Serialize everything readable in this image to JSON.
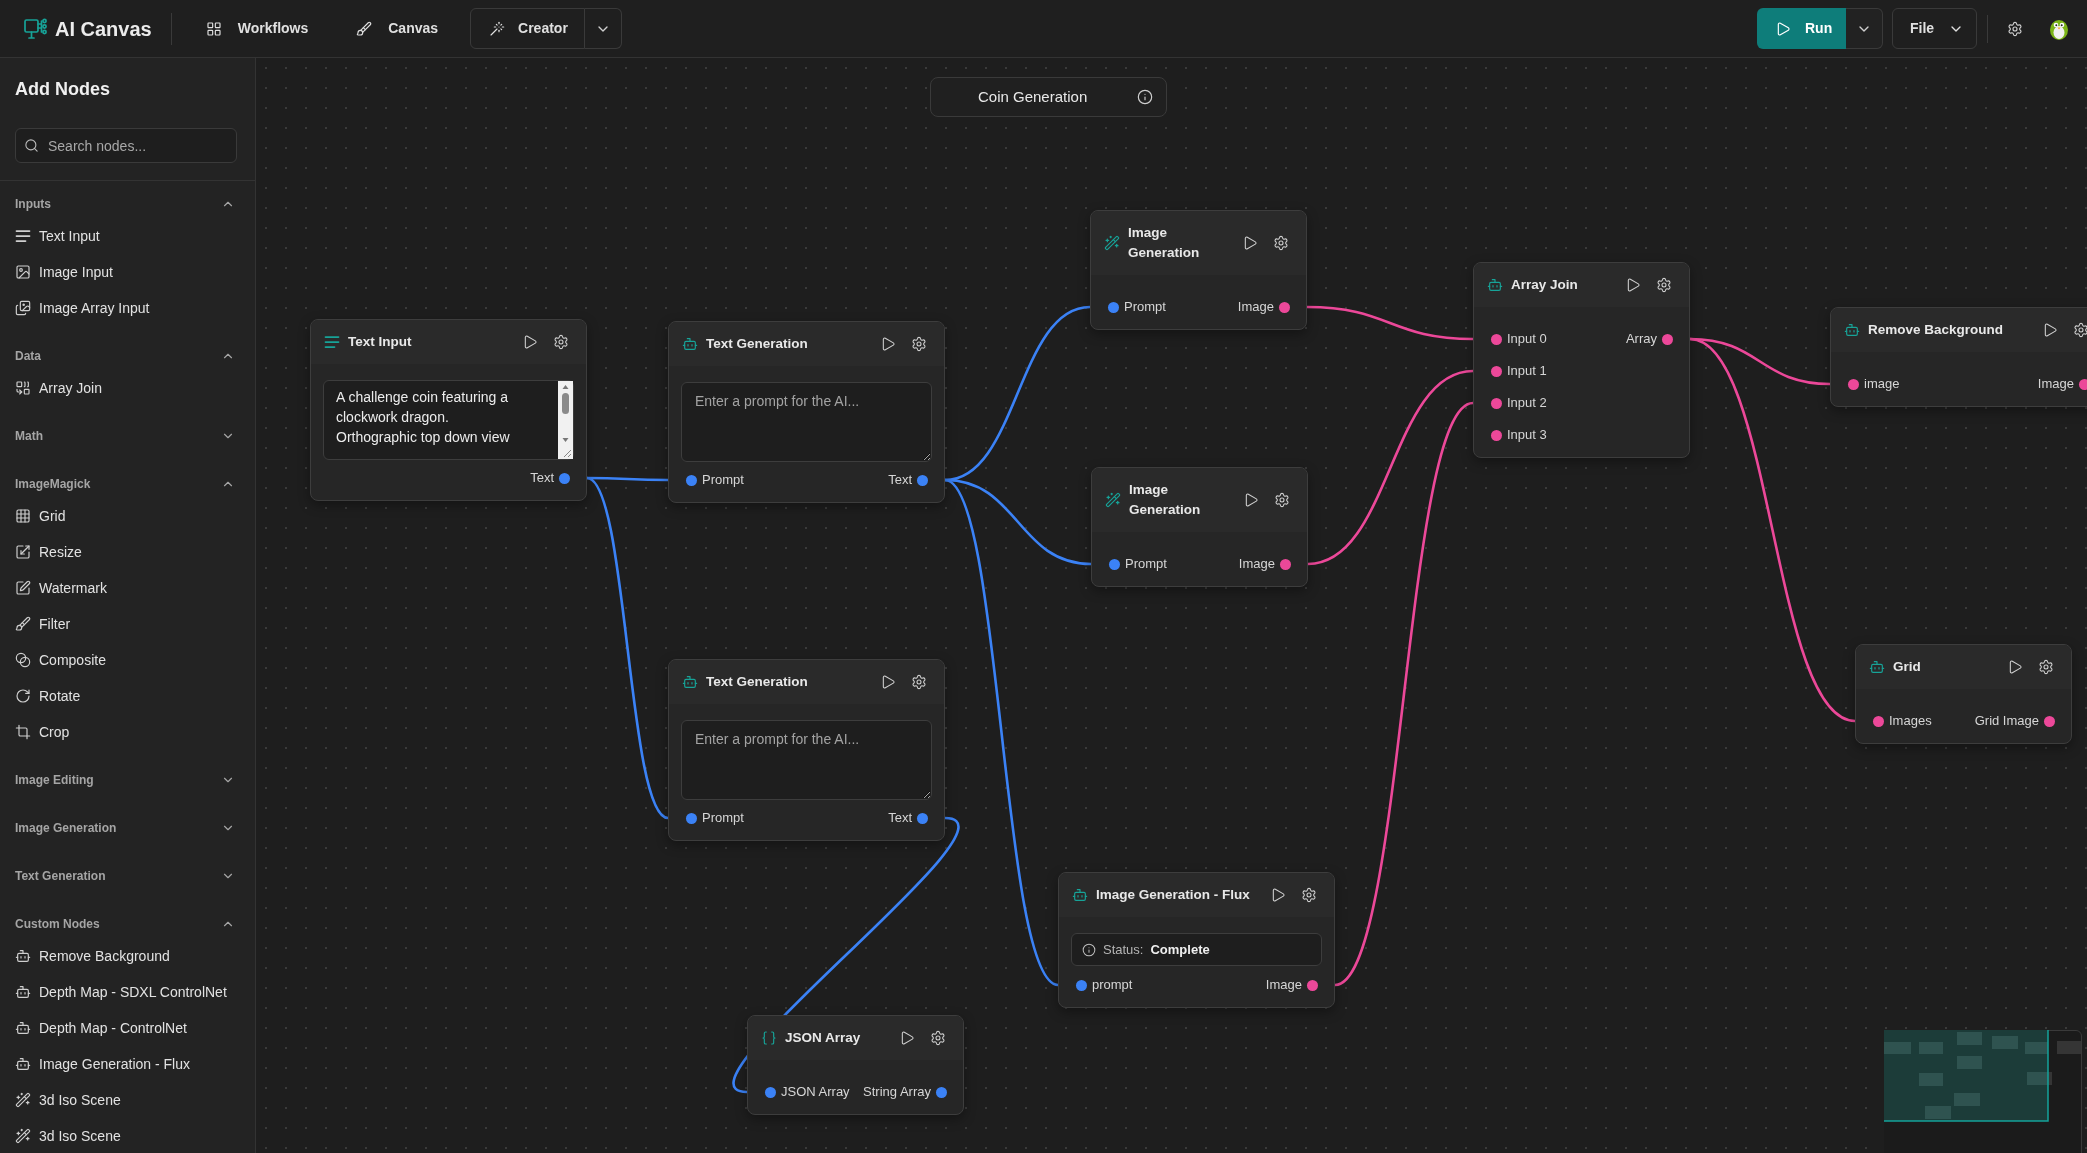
{
  "header": {
    "app_name": "AI Canvas",
    "nav": [
      {
        "label": "Workflows"
      },
      {
        "label": "Canvas"
      }
    ],
    "mode": {
      "label": "Creator"
    },
    "run": {
      "label": "Run"
    },
    "file": {
      "label": "File"
    }
  },
  "sidebar": {
    "title": "Add Nodes",
    "search": {
      "placeholder": "Search nodes..."
    },
    "sections": [
      {
        "title": "Inputs",
        "expanded": true,
        "items": [
          "Text Input",
          "Image Input",
          "Image Array Input"
        ]
      },
      {
        "title": "Data",
        "expanded": true,
        "items": [
          "Array Join"
        ]
      },
      {
        "title": "Math",
        "expanded": false
      },
      {
        "title": "ImageMagick",
        "expanded": true,
        "items": [
          "Grid",
          "Resize",
          "Watermark",
          "Filter",
          "Composite",
          "Rotate",
          "Crop"
        ]
      },
      {
        "title": "Image Editing",
        "expanded": false
      },
      {
        "title": "Image Generation",
        "expanded": false
      },
      {
        "title": "Text Generation",
        "expanded": false
      },
      {
        "title": "Custom Nodes",
        "expanded": true,
        "items": [
          "Remove Background",
          "Depth Map - SDXL ControlNet",
          "Depth Map - ControlNet",
          "Image Generation - Flux",
          "3d Iso Scene",
          "3d Iso Scene"
        ]
      }
    ]
  },
  "canvas": {
    "title": "Coin Generation",
    "nodes": [
      {
        "title": "Text Input",
        "kind": "text_input",
        "value": "A challenge coin featuring a clockwork dragon. Orthographic top down view",
        "outputs": [
          {
            "label": "Text",
            "color": "#3b82f6"
          }
        ]
      },
      {
        "title": "Text Generation",
        "kind": "prompt",
        "placeholder": "Enter a prompt for the AI...",
        "inputs": [
          {
            "label": "Prompt",
            "color": "#3b82f6"
          }
        ],
        "outputs": [
          {
            "label": "Text",
            "color": "#3b82f6"
          }
        ]
      },
      {
        "title": "Text Generation",
        "kind": "prompt",
        "placeholder": "Enter a prompt for the AI...",
        "inputs": [
          {
            "label": "Prompt",
            "color": "#3b82f6"
          }
        ],
        "outputs": [
          {
            "label": "Text",
            "color": "#3b82f6"
          }
        ]
      },
      {
        "title": "Image Generation",
        "kind": "ports",
        "inputs": [
          {
            "label": "Prompt",
            "color": "#3b82f6"
          }
        ],
        "outputs": [
          {
            "label": "Image",
            "color": "#ec4899"
          }
        ]
      },
      {
        "title": "Image Generation",
        "kind": "ports",
        "inputs": [
          {
            "label": "Prompt",
            "color": "#3b82f6"
          }
        ],
        "outputs": [
          {
            "label": "Image",
            "color": "#ec4899"
          }
        ]
      },
      {
        "title": "Image Generation - Flux",
        "kind": "status",
        "status": {
          "label": "Status:",
          "value": "Complete"
        },
        "inputs": [
          {
            "label": "prompt",
            "color": "#3b82f6"
          }
        ],
        "outputs": [
          {
            "label": "Image",
            "color": "#ec4899"
          }
        ]
      },
      {
        "title": "JSON Array",
        "kind": "ports",
        "inputs": [
          {
            "label": "JSON Array",
            "color": "#3b82f6"
          }
        ],
        "outputs": [
          {
            "label": "String Array",
            "color": "#3b82f6"
          }
        ]
      },
      {
        "title": "Array Join",
        "kind": "ports",
        "inputs": [
          {
            "label": "Input 0",
            "color": "#ec4899"
          },
          {
            "label": "Input 1",
            "color": "#ec4899"
          },
          {
            "label": "Input 2",
            "color": "#ec4899"
          },
          {
            "label": "Input 3",
            "color": "#ec4899"
          }
        ],
        "outputs": [
          {
            "label": "Array",
            "color": "#ec4899"
          }
        ]
      },
      {
        "title": "Remove Background",
        "kind": "ports",
        "inputs": [
          {
            "label": "image",
            "color": "#ec4899"
          }
        ],
        "outputs": [
          {
            "label": "Image",
            "color": "#ec4899"
          }
        ]
      },
      {
        "title": "Grid",
        "kind": "ports",
        "inputs": [
          {
            "label": "Images",
            "color": "#ec4899"
          }
        ],
        "outputs": [
          {
            "label": "Grid Image",
            "color": "#ec4899"
          }
        ]
      }
    ]
  }
}
